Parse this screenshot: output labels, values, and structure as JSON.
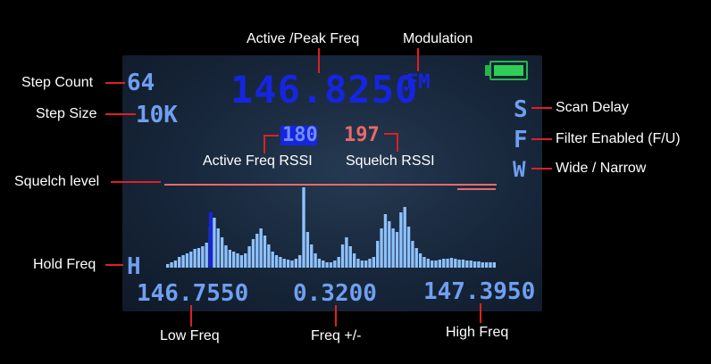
{
  "annotations": {
    "peak_freq": "Active /Peak Freq",
    "modulation": "Modulation",
    "step_count": "Step Count",
    "step_size": "Step Size",
    "scan_delay": "Scan Delay",
    "filter": "Filter Enabled (F/U)",
    "active_rssi": "Active Freq RSSI",
    "squelch_rssi": "Squelch RSSI",
    "wide_narrow": "Wide / Narrow",
    "squelch_level": "Squelch level",
    "hold_freq": "Hold Freq",
    "low_freq": "Low Freq",
    "freq_step": "Freq +/-",
    "high_freq": "High Freq"
  },
  "display": {
    "step_count": "64",
    "step_size": "10K",
    "peak_freq": "146.8250",
    "modulation": "FM",
    "scan_delay": "S",
    "filter": "F",
    "wide_narrow": "W",
    "active_rssi": "180",
    "squelch_rssi": "197",
    "hold": "H",
    "low_freq": "146.7550",
    "freq_step": "0.3200",
    "high_freq": "147.3950"
  },
  "colors": {
    "lcd_blue": "#6f9ff0",
    "freq_blue": "#1625e0",
    "squelch_red": "#e86a6a",
    "battery_green": "#2fcf57",
    "callout_red": "#e02020"
  },
  "spectrum": {
    "levels": [
      4,
      6,
      8,
      12,
      14,
      16,
      18,
      21,
      22,
      24,
      28,
      46,
      56,
      44,
      34,
      25,
      20,
      18,
      16,
      14,
      16,
      24,
      32,
      38,
      44,
      36,
      26,
      18,
      14,
      12,
      10,
      9,
      8,
      10,
      14,
      90,
      40,
      26,
      16,
      10,
      8,
      6,
      6,
      8,
      12,
      26,
      34,
      24,
      16,
      10,
      8,
      8,
      10,
      12,
      30,
      44,
      60,
      52,
      44,
      40,
      62,
      68,
      46,
      30,
      22,
      16,
      12,
      10,
      8,
      8,
      9,
      10,
      10,
      11,
      10,
      9,
      9,
      8,
      8,
      7,
      7,
      6,
      6,
      6,
      6
    ],
    "active_index": 11,
    "squelch_level": 0.62
  }
}
